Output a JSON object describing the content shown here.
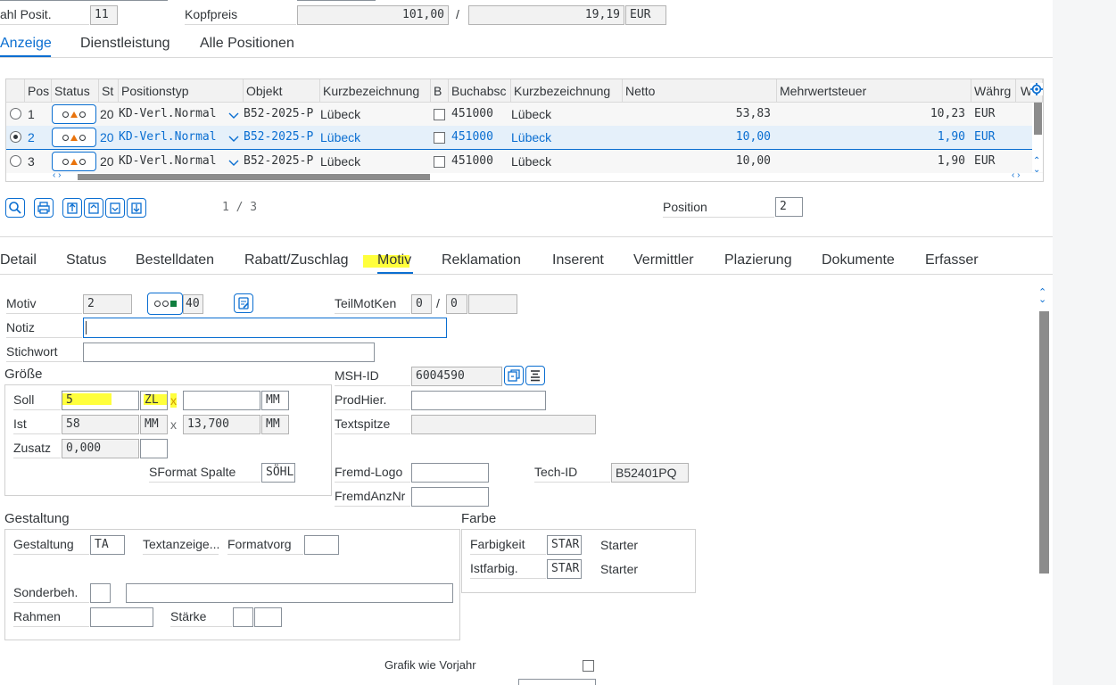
{
  "header": {
    "anz_posit_label": "ahl Posit.",
    "anz_posit_value": "11",
    "kopfpreis_label": "Kopfpreis",
    "kopfpreis_netto": "101,00",
    "kopfpreis_sep": "/",
    "kopfpreis_mwst": "19,19",
    "currency": "EUR"
  },
  "top_tabs": [
    {
      "label": "Anzeige",
      "active": true
    },
    {
      "label": "Dienstleistung",
      "active": false
    },
    {
      "label": "Alle Positionen",
      "active": false
    }
  ],
  "table": {
    "columns": [
      "Pos",
      "Status",
      "St",
      "Positionstyp",
      "Objekt",
      "Kurzbezeichnung",
      "B",
      "Buchabsc",
      "Kurzbezeichnung",
      "Netto",
      "Mehrwertsteuer",
      "Währg",
      "Werbekon"
    ],
    "rows": [
      {
        "pos": "1",
        "st": "20",
        "typ": "KD-Verl.Normal",
        "objekt": "B52-2025-P",
        "kurz": "Lübeck",
        "buch": "451000",
        "kurz2": "Lübeck",
        "netto": "53,83",
        "mwst": "10,23",
        "waehrg": "EUR",
        "selected": false
      },
      {
        "pos": "2",
        "st": "20",
        "typ": "KD-Verl.Normal",
        "objekt": "B52-2025-P",
        "kurz": "Lübeck",
        "buch": "451000",
        "kurz2": "Lübeck",
        "netto": "10,00",
        "mwst": "1,90",
        "waehrg": "EUR",
        "selected": true
      },
      {
        "pos": "3",
        "st": "20",
        "typ": "KD-Verl.Normal",
        "objekt": "B52-2025-P",
        "kurz": "Lübeck",
        "buch": "451000",
        "kurz2": "Lübeck",
        "netto": "10,00",
        "mwst": "1,90",
        "waehrg": "EUR",
        "selected": false
      }
    ]
  },
  "toolbar": {
    "page_indicator": "1 / 3",
    "position_label": "Position",
    "position_value": "2"
  },
  "detail_tabs": [
    {
      "label": "Detail",
      "active": false
    },
    {
      "label": "Status",
      "active": false
    },
    {
      "label": "Bestelldaten",
      "active": false
    },
    {
      "label": "Rabatt/Zuschlag",
      "active": false
    },
    {
      "label": "Motiv",
      "active": true
    },
    {
      "label": "Reklamation",
      "active": false
    },
    {
      "label": "Inserent",
      "active": false
    },
    {
      "label": "Vermittler",
      "active": false
    },
    {
      "label": "Plazierung",
      "active": false
    },
    {
      "label": "Dokumente",
      "active": false
    },
    {
      "label": "Erfasser",
      "active": false
    }
  ],
  "motiv": {
    "motiv_label": "Motiv",
    "motiv_value": "2",
    "status_value": "40",
    "teilmotken_label": "TeilMotKen",
    "teilmotken_a": "0",
    "teilmotken_sep": "/",
    "teilmotken_b": "0",
    "notiz_label": "Notiz",
    "notiz_value": "",
    "stichwort_label": "Stichwort",
    "stichwort_value": ""
  },
  "groesse": {
    "title": "Größe",
    "soll_label": "Soll",
    "soll_value": "5",
    "soll_unit": "ZL",
    "soll_x": "x",
    "soll_value2": "",
    "soll_unit2": "MM",
    "ist_label": "Ist",
    "ist_value": "58",
    "ist_unit": "MM",
    "ist_x": "x",
    "ist_value2": "13,700",
    "ist_unit2": "MM",
    "zusatz_label": "Zusatz",
    "zusatz_value": "0,000",
    "sformat_label": "SFormat Spalte",
    "sformat_value": "SÖHL"
  },
  "right_fields": {
    "mshid_label": "MSH-ID",
    "mshid_value": "6004590",
    "prodhier_label": "ProdHier.",
    "textspitze_label": "Textspitze",
    "fremdlogo_label": "Fremd-Logo",
    "fremdanznr_label": "FremdAnzNr",
    "techid_label": "Tech-ID",
    "techid_value": "B52401PQ"
  },
  "gestaltung": {
    "title": "Gestaltung",
    "gestaltung_label": "Gestaltung",
    "gestaltung_value": "TA",
    "textanzeige_label": "Textanzeige...",
    "formatvorg_label": "Formatvorg",
    "sonderbeh_label": "Sonderbeh.",
    "rahmen_label": "Rahmen",
    "staerke_label": "Stärke"
  },
  "farbe": {
    "title": "Farbe",
    "farbigkeit_label": "Farbigkeit",
    "farbigkeit_value": "STAR",
    "farbigkeit_text": "Starter",
    "istfarbig_label": "Istfarbig.",
    "istfarbig_value": "STAR",
    "istfarbig_text": "Starter"
  },
  "footer": {
    "grafik_label": "Grafik wie Vorjahr"
  },
  "colors": {
    "accent": "#0a6ed1",
    "highlight": "#ffff3c",
    "selected_row": "#e5f0fa"
  }
}
